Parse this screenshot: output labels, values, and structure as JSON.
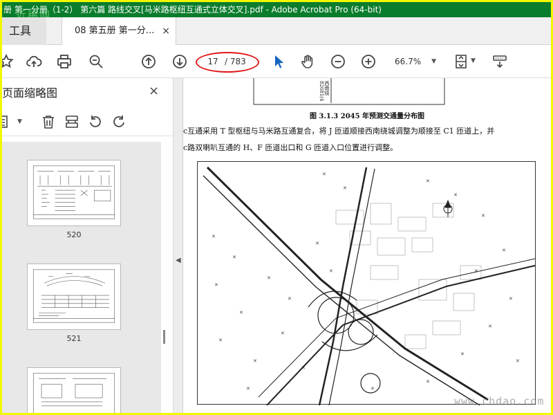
{
  "window": {
    "title": "册 第一分册（1-2） 第六篇 路线交叉[马米路枢纽互通式立体交叉].pdf - Adobe Acrobat Pro (64-bit)",
    "watermark": "近稀网"
  },
  "tabs": {
    "tools_label": "工具",
    "doc_label": "08 第五册 第一分...",
    "close_symbol": "×"
  },
  "toolbar": {
    "page_current": "17",
    "page_total": "/ 783",
    "zoom": "66.7%",
    "caret": "▼"
  },
  "panel": {
    "title": "页面缩略图",
    "close_symbol": "×",
    "thumbnails": [
      {
        "label": "520"
      },
      {
        "label": "521"
      }
    ]
  },
  "collapse_arrow": "◀",
  "document": {
    "figure_top_label1": "西南绕",
    "figure_top_label2": "82681(4",
    "caption": "图 3.1.3    2045 年预测交通量分布图",
    "para1": "c互通采用 T 型枢纽与马米路互通复合，将 J 匝道顺接西南绕城调整为顺接至 C1 匝道上，并",
    "para2": "c路双喇叭互通的 H、F 匝道出口和 G 匝道入口位置进行调整。"
  },
  "site_watermark": "www.chdao.com",
  "colors": {
    "title_bar": "#0a7d2c",
    "frame": "#f3f800",
    "highlight_oval": "#e01818",
    "select_arrow": "#1565c0"
  },
  "icons": [
    "star-icon",
    "cloud-upload-icon",
    "print-icon",
    "zoom-search-icon",
    "arrow-up-icon",
    "arrow-down-icon",
    "select-arrow-icon",
    "hand-icon",
    "zoom-out-icon",
    "zoom-in-icon",
    "fit-page-icon",
    "keyboard-icon",
    "list-icon",
    "trash-icon",
    "cut-icon",
    "rotate-ccw-icon",
    "rotate-cw-icon"
  ]
}
